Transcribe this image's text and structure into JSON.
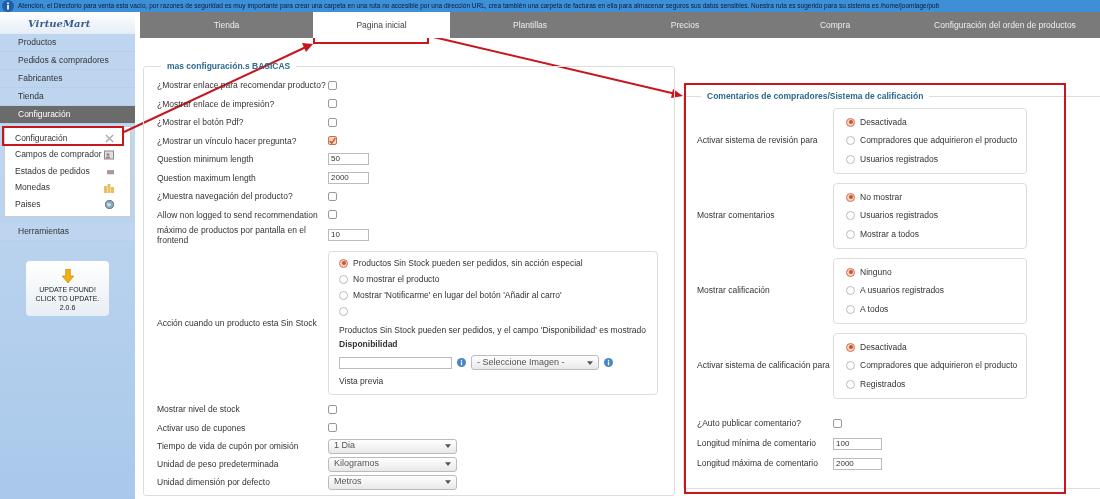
{
  "banner": {
    "text": "Atención, el Directorio para venta esta vacío, por razones de seguridad es muy importante para crear una carpeta en una ruta no accesible por una dirección URL, crea también una carpeta de facturas en ella para almacenar seguros sus datos sensibles. Nuestra ruta es sugerido para su sistema es /home/joomlage/pub"
  },
  "logo": {
    "text": "VirtueMart"
  },
  "tabs": [
    {
      "label": "Tienda",
      "selected": false
    },
    {
      "label": "Pagina inicial",
      "selected": true
    },
    {
      "label": "Plantillas",
      "selected": false
    },
    {
      "label": "Precios",
      "selected": false
    },
    {
      "label": "Compra",
      "selected": false
    },
    {
      "label": "Configuración del orden de productos",
      "selected": false
    }
  ],
  "sidebar": {
    "items": [
      {
        "label": "Productos",
        "selected": false
      },
      {
        "label": "Pedidos & compradores",
        "selected": false
      },
      {
        "label": "Fabricantes",
        "selected": false
      },
      {
        "label": "Tienda",
        "selected": false
      },
      {
        "label": "Configuración",
        "selected": true,
        "children": [
          {
            "label": "Configuración",
            "kind": "tools"
          },
          {
            "label": "Campos de comprador",
            "kind": "card"
          },
          {
            "label": "Estados de pedidos",
            "kind": "boxes"
          },
          {
            "label": "Monedas",
            "kind": "coins"
          },
          {
            "label": "Paises",
            "kind": "globe"
          }
        ]
      },
      {
        "label": "Herramientas",
        "selected": false
      }
    ],
    "update": {
      "lines": [
        "UPDATE FOUND!",
        "CLICK TO UPDATE.",
        "2.0.6"
      ]
    }
  },
  "basic": {
    "title": "mas configuración.s BASICAS",
    "rows": [
      {
        "kind": "checkbox",
        "label": "¿Mostrar enlace para recomendar producto?",
        "checked": false
      },
      {
        "kind": "checkbox",
        "label": "¿Mostrar enlace de impresión?",
        "checked": false
      },
      {
        "kind": "checkbox",
        "label": "¿Mostrar el botón Pdf?",
        "checked": false
      },
      {
        "kind": "checkbox",
        "label": "¿Mostrar un vínculo hacer pregunta?",
        "checked": true
      },
      {
        "kind": "text",
        "label": "Question minimum length",
        "value": "50"
      },
      {
        "kind": "text",
        "label": "Question maximum length",
        "value": "2000"
      },
      {
        "kind": "checkbox",
        "label": "¿Muestra navegación del producto?",
        "checked": false
      },
      {
        "kind": "checkbox",
        "label": "Allow non logged to send recommendation",
        "checked": false
      },
      {
        "kind": "text",
        "label": "máximo de productos por pantalla en el frontend",
        "value": "10"
      },
      {
        "kind": "stock",
        "label": "Acción cuando un producto esta Sin Stock",
        "options": [
          {
            "label": "Productos Sin Stock pueden ser pedidos, sin acción especial",
            "selected": true
          },
          {
            "label": "No mostrar el producto",
            "selected": false
          },
          {
            "label": "Mostrar 'Notificarme' en lugar del botón 'Añadir al carro'",
            "selected": false
          },
          {
            "selected": false
          }
        ],
        "note": "Productos Sin Stock pueden ser pedidos, y el campo 'Disponibilidad' es mostrado",
        "field_label": "Disponibilidad",
        "image_select": "- Seleccione Imagen -",
        "preview": "Vista previa"
      },
      {
        "kind": "checkbox",
        "label": "Mostrar nivel de stock",
        "checked": false
      },
      {
        "kind": "checkbox",
        "label": "Activar uso de cupones",
        "checked": false
      },
      {
        "kind": "select",
        "label": "Tiempo de vida de cupón por omisión",
        "value": "1 Dia"
      },
      {
        "kind": "select",
        "label": "Unidad de peso predeterminada",
        "value": "Kilogramos"
      },
      {
        "kind": "select",
        "label": "Unidad dimensión por defecto",
        "value": "Metros"
      }
    ]
  },
  "reviews": {
    "title": "Comentarios de compradores/Sistema de calificación",
    "rows": [
      {
        "kind": "radio_group",
        "label": "Activar sistema de revisión para",
        "options": [
          {
            "label": "Desactivada",
            "selected": true
          },
          {
            "label": "Compradores que adquirieron el producto",
            "selected": false
          },
          {
            "label": "Usuarios registrados",
            "selected": false
          }
        ]
      },
      {
        "kind": "radio_group",
        "label": "Mostrar comentarios",
        "options": [
          {
            "label": "No mostrar",
            "selected": true
          },
          {
            "label": "Usuarios registrados",
            "selected": false
          },
          {
            "label": "Mostrar a todos",
            "selected": false
          }
        ]
      },
      {
        "kind": "radio_group",
        "label": "Mostrar calificación",
        "options": [
          {
            "label": "Ninguno",
            "selected": true
          },
          {
            "label": "A usuarios registrados",
            "selected": false
          },
          {
            "label": "A todos",
            "selected": false
          }
        ]
      },
      {
        "kind": "radio_group",
        "label": "Activar sistema de calificación para",
        "options": [
          {
            "label": "Desactivada",
            "selected": true
          },
          {
            "label": "Compradores que adquirieron el producto",
            "selected": false
          },
          {
            "label": "Registrados",
            "selected": false
          }
        ]
      },
      {
        "kind": "checkbox",
        "label": "¿Auto publicar comentario?",
        "checked": false
      },
      {
        "kind": "text",
        "label": "Longitud mínima de comentario",
        "value": "100"
      },
      {
        "kind": "text",
        "label": "Longitud máxima de comentario",
        "value": "2000"
      }
    ]
  }
}
